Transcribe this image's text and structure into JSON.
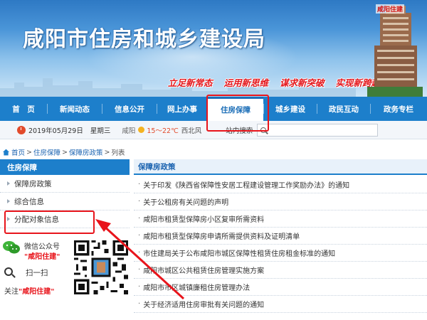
{
  "header": {
    "site_title": "咸阳市住房和城乡建设局",
    "slogans": [
      "立足新常态",
      "运用新思维",
      "谋求新突破",
      "实现新跨越"
    ],
    "building_name": "咸阳住建"
  },
  "nav": {
    "items": [
      {
        "label": "首　页",
        "active": false
      },
      {
        "label": "新闻动态",
        "active": false
      },
      {
        "label": "信息公开",
        "active": false
      },
      {
        "label": "网上办事",
        "active": false
      },
      {
        "label": "住房保障",
        "active": true
      },
      {
        "label": "城乡建设",
        "active": false
      },
      {
        "label": "政民互动",
        "active": false
      },
      {
        "label": "政务专栏",
        "active": false
      }
    ]
  },
  "infobar": {
    "date": "2019年05月29日",
    "weekday": "星期三",
    "weather_city": "咸阳",
    "temperature": "15～22℃",
    "wind": "西北风",
    "search_label": "站内搜索",
    "search_value": ""
  },
  "breadcrumb": {
    "home": "首页",
    "section": "住房保障",
    "subsection": "保障房政策",
    "current": "列表",
    "sep": ">"
  },
  "sidebar": {
    "heading": "住房保障",
    "items": [
      {
        "label": "保障房政策"
      },
      {
        "label": "综合信息"
      },
      {
        "label": "分配对象信息"
      }
    ]
  },
  "promo": {
    "wechat_line": "微信公众号",
    "account_name": "\"咸阳住建\"",
    "scan_label": "扫一扫",
    "follow_prefix": "关注",
    "follow_name": "\"咸阳住建\""
  },
  "main": {
    "heading": "保障房政策",
    "bullet": "·",
    "articles": [
      "关于印发《陕西省保障性安居工程建设管理工作奖励办法》的通知",
      "关于公租房有关问题的声明",
      "咸阳市租赁型保障房小区复审所需资料",
      "咸阳市租赁型保障房申请所需提供资料及证明清单",
      "市住建局关于公布咸阳市城区保障性租赁住房租金标准的通知",
      "咸阳市城区公共租赁住房管理实施方案",
      "咸阳市市区城镇廉租住房管理办法",
      "关于经济适用住房审批有关问题的通知"
    ]
  },
  "colors": {
    "nav_blue": "#1d7fcb",
    "slogan_red": "#e4161b",
    "highlight_red": "#e8141b",
    "link_blue": "#1b63b0"
  },
  "icons": [
    "home-icon",
    "clock-icon",
    "sun-icon",
    "search-icon",
    "wechat-icon",
    "scan-icon",
    "qr-code"
  ]
}
